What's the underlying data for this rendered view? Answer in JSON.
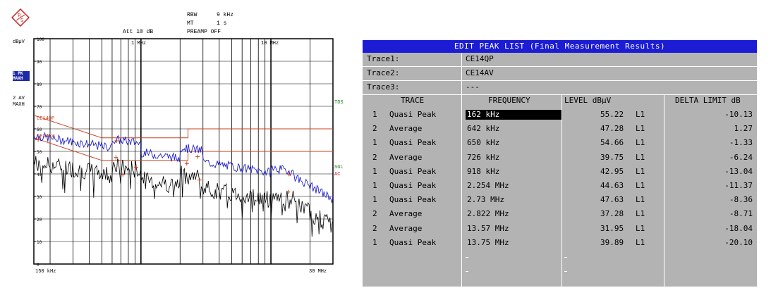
{
  "header": {
    "rbw_label": "RBW",
    "rbw_value": "9 kHz",
    "mt_label": "MT",
    "mt_value": "1 s",
    "att": "Att 10 dB",
    "preamp": "PREAMP OFF"
  },
  "plot": {
    "unit_label": "dBµV",
    "y_ticks": [
      "100",
      "90",
      "80",
      "70",
      "60",
      "50",
      "40",
      "30",
      "20",
      "10",
      "0"
    ],
    "x_start": "150 kHz",
    "x_end": "30 MHz",
    "x_mark_1": "1 MHz",
    "x_mark_2": "10 MHz",
    "trace1_box": "1 PK",
    "trace1_sub": "MAXH",
    "trace2_label": "2 AV",
    "trace2_sub": "MAXH",
    "limit_qp": "CE14QP",
    "limit_av": "CE14AV",
    "right_tdf": "TDS",
    "right_sgl": "SGL",
    "right_ac": "AC",
    "colors": {
      "pk_trace": "#2020c8",
      "av_trace": "#000000",
      "limit": "#c84020",
      "grid": "#000000"
    },
    "y_range": [
      0,
      100
    ]
  },
  "peak_list": {
    "title": "EDIT PEAK LIST (Final Measurement Results)",
    "trace1_label": "Trace1:",
    "trace1_value": "CE14QP",
    "trace2_label": "Trace2:",
    "trace2_value": "CE14AV",
    "trace3_label": "Trace3:",
    "trace3_value": "---",
    "columns": [
      "TRACE",
      "FREQUENCY",
      "LEVEL dBµV",
      "DELTA LIMIT dB"
    ],
    "rows": [
      {
        "trace": "1",
        "type": "Quasi Peak",
        "freq": "162 kHz",
        "level": "55.22",
        "ln": "L1",
        "delta": "-10.13"
      },
      {
        "trace": "2",
        "type": "Average",
        "freq": "642 kHz",
        "level": "47.28",
        "ln": "L1",
        "delta": "1.27"
      },
      {
        "trace": "1",
        "type": "Quasi Peak",
        "freq": "650 kHz",
        "level": "54.66",
        "ln": "L1",
        "delta": "-1.33"
      },
      {
        "trace": "2",
        "type": "Average",
        "freq": "726 kHz",
        "level": "39.75",
        "ln": "L1",
        "delta": "-6.24"
      },
      {
        "trace": "1",
        "type": "Quasi Peak",
        "freq": "918 kHz",
        "level": "42.95",
        "ln": "L1",
        "delta": "-13.04"
      },
      {
        "trace": "1",
        "type": "Quasi Peak",
        "freq": "2.254 MHz",
        "level": "44.63",
        "ln": "L1",
        "delta": "-11.37"
      },
      {
        "trace": "1",
        "type": "Quasi Peak",
        "freq": "2.73 MHz",
        "level": "47.63",
        "ln": "L1",
        "delta": "-8.36"
      },
      {
        "trace": "2",
        "type": "Average",
        "freq": "2.822 MHz",
        "level": "37.28",
        "ln": "L1",
        "delta": "-8.71"
      },
      {
        "trace": "2",
        "type": "Average",
        "freq": "13.57 MHz",
        "level": "31.95",
        "ln": "L1",
        "delta": "-18.04"
      },
      {
        "trace": "1",
        "type": "Quasi Peak",
        "freq": "13.75 MHz",
        "level": "39.89",
        "ln": "L1",
        "delta": "-20.10"
      }
    ]
  }
}
